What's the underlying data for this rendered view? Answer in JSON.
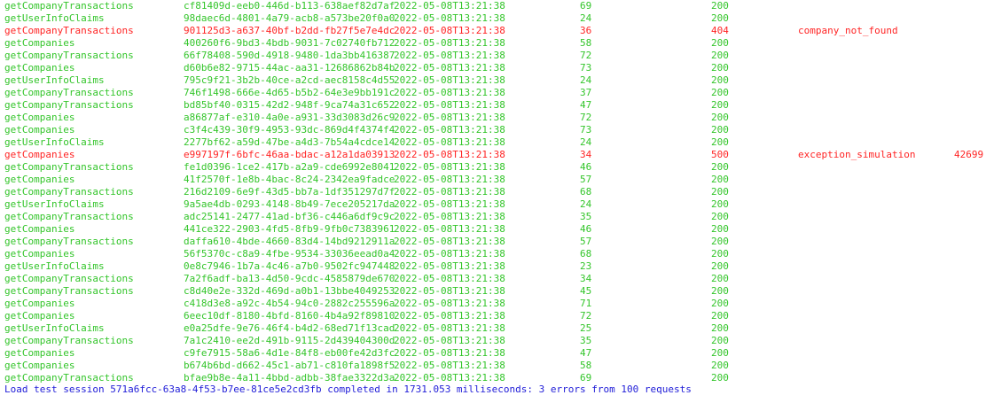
{
  "log": {
    "rows": [
      {
        "op": "getCompanyTransactions",
        "id": "cf81409d-eeb0-446d-b113-638aef82d7af",
        "ts": "2022-05-08T13:21:38",
        "ms": "69",
        "status": "200",
        "error": "",
        "extra": "",
        "is_error": false
      },
      {
        "op": "getUserInfoClaims",
        "id": "98daec6d-4801-4a79-acb8-a573be20f0a0",
        "ts": "2022-05-08T13:21:38",
        "ms": "24",
        "status": "200",
        "error": "",
        "extra": "",
        "is_error": false
      },
      {
        "op": "getCompanyTransactions",
        "id": "901125d3-a637-40bf-b2dd-fb27f5e7e4dc",
        "ts": "2022-05-08T13:21:38",
        "ms": "36",
        "status": "404",
        "error": "company_not_found",
        "extra": "",
        "is_error": true
      },
      {
        "op": "getCompanies",
        "id": "400260f6-9bd3-4bdb-9031-7c02740fb712",
        "ts": "2022-05-08T13:21:38",
        "ms": "58",
        "status": "200",
        "error": "",
        "extra": "",
        "is_error": false
      },
      {
        "op": "getCompanyTransactions",
        "id": "66f78408-590d-4918-9480-1da3bb416387",
        "ts": "2022-05-08T13:21:38",
        "ms": "72",
        "status": "200",
        "error": "",
        "extra": "",
        "is_error": false
      },
      {
        "op": "getCompanies",
        "id": "d60b6e82-9715-44ac-aa31-12686862b84b",
        "ts": "2022-05-08T13:21:38",
        "ms": "73",
        "status": "200",
        "error": "",
        "extra": "",
        "is_error": false
      },
      {
        "op": "getUserInfoClaims",
        "id": "795c9f21-3b2b-40ce-a2cd-aec8158c4d55",
        "ts": "2022-05-08T13:21:38",
        "ms": "24",
        "status": "200",
        "error": "",
        "extra": "",
        "is_error": false
      },
      {
        "op": "getCompanyTransactions",
        "id": "746f1498-666e-4d65-b5b2-64e3e9bb191c",
        "ts": "2022-05-08T13:21:38",
        "ms": "37",
        "status": "200",
        "error": "",
        "extra": "",
        "is_error": false
      },
      {
        "op": "getCompanyTransactions",
        "id": "bd85bf40-0315-42d2-948f-9ca74a31c652",
        "ts": "2022-05-08T13:21:38",
        "ms": "47",
        "status": "200",
        "error": "",
        "extra": "",
        "is_error": false
      },
      {
        "op": "getCompanies",
        "id": "a86877af-e310-4a0e-a931-33d3083d26c9",
        "ts": "2022-05-08T13:21:38",
        "ms": "72",
        "status": "200",
        "error": "",
        "extra": "",
        "is_error": false
      },
      {
        "op": "getCompanies",
        "id": "c3f4c439-30f9-4953-93dc-869d4f4374f4",
        "ts": "2022-05-08T13:21:38",
        "ms": "73",
        "status": "200",
        "error": "",
        "extra": "",
        "is_error": false
      },
      {
        "op": "getUserInfoClaims",
        "id": "2277bf62-a59d-47be-a4d3-7b54a4cdce14",
        "ts": "2022-05-08T13:21:38",
        "ms": "24",
        "status": "200",
        "error": "",
        "extra": "",
        "is_error": false
      },
      {
        "op": "getCompanies",
        "id": "e997197f-6bfc-46aa-bdac-a12a1da03913",
        "ts": "2022-05-08T13:21:38",
        "ms": "34",
        "status": "500",
        "error": "exception_simulation",
        "extra": "42699",
        "is_error": true
      },
      {
        "op": "getCompanyTransactions",
        "id": "fe1d0396-1ce2-417b-a2a9-cde6992e8041",
        "ts": "2022-05-08T13:21:38",
        "ms": "46",
        "status": "200",
        "error": "",
        "extra": "",
        "is_error": false
      },
      {
        "op": "getCompanies",
        "id": "41f2570f-1e8b-4bac-8c24-2342ea9fadce",
        "ts": "2022-05-08T13:21:38",
        "ms": "57",
        "status": "200",
        "error": "",
        "extra": "",
        "is_error": false
      },
      {
        "op": "getCompanyTransactions",
        "id": "216d2109-6e9f-43d5-bb7a-1df351297d7f",
        "ts": "2022-05-08T13:21:38",
        "ms": "68",
        "status": "200",
        "error": "",
        "extra": "",
        "is_error": false
      },
      {
        "op": "getUserInfoClaims",
        "id": "9a5ae4db-0293-4148-8b49-7ece205217da",
        "ts": "2022-05-08T13:21:38",
        "ms": "24",
        "status": "200",
        "error": "",
        "extra": "",
        "is_error": false
      },
      {
        "op": "getCompanyTransactions",
        "id": "adc25141-2477-41ad-bf36-c446a6df9c9c",
        "ts": "2022-05-08T13:21:38",
        "ms": "35",
        "status": "200",
        "error": "",
        "extra": "",
        "is_error": false
      },
      {
        "op": "getCompanies",
        "id": "441ce322-2903-4fd5-8fb9-9fb0c7383961",
        "ts": "2022-05-08T13:21:38",
        "ms": "46",
        "status": "200",
        "error": "",
        "extra": "",
        "is_error": false
      },
      {
        "op": "getCompanyTransactions",
        "id": "daffa610-4bde-4660-83d4-14bd9212911a",
        "ts": "2022-05-08T13:21:38",
        "ms": "57",
        "status": "200",
        "error": "",
        "extra": "",
        "is_error": false
      },
      {
        "op": "getCompanies",
        "id": "56f5370c-c8a9-4fbe-9534-33036eead0a4",
        "ts": "2022-05-08T13:21:38",
        "ms": "68",
        "status": "200",
        "error": "",
        "extra": "",
        "is_error": false
      },
      {
        "op": "getUserInfoClaims",
        "id": "0e8c7946-1b7a-4c46-a7b0-9502fc947448",
        "ts": "2022-05-08T13:21:38",
        "ms": "23",
        "status": "200",
        "error": "",
        "extra": "",
        "is_error": false
      },
      {
        "op": "getCompanyTransactions",
        "id": "7a2f6adf-ba13-4d50-9cdc-4585879de670",
        "ts": "2022-05-08T13:21:38",
        "ms": "34",
        "status": "200",
        "error": "",
        "extra": "",
        "is_error": false
      },
      {
        "op": "getCompanyTransactions",
        "id": "c8d40e2e-332d-469d-a0b1-13bbe4049253",
        "ts": "2022-05-08T13:21:38",
        "ms": "45",
        "status": "200",
        "error": "",
        "extra": "",
        "is_error": false
      },
      {
        "op": "getCompanies",
        "id": "c418d3e8-a92c-4b54-94c0-2882c255596a",
        "ts": "2022-05-08T13:21:38",
        "ms": "71",
        "status": "200",
        "error": "",
        "extra": "",
        "is_error": false
      },
      {
        "op": "getCompanies",
        "id": "6eec10df-8180-4bfd-8160-4b4a92f89810",
        "ts": "2022-05-08T13:21:38",
        "ms": "72",
        "status": "200",
        "error": "",
        "extra": "",
        "is_error": false
      },
      {
        "op": "getUserInfoClaims",
        "id": "e0a25dfe-9e76-46f4-b4d2-68ed71f13cad",
        "ts": "2022-05-08T13:21:38",
        "ms": "25",
        "status": "200",
        "error": "",
        "extra": "",
        "is_error": false
      },
      {
        "op": "getCompanyTransactions",
        "id": "7a1c2410-ee2d-491b-9115-2d439404300d",
        "ts": "2022-05-08T13:21:38",
        "ms": "35",
        "status": "200",
        "error": "",
        "extra": "",
        "is_error": false
      },
      {
        "op": "getCompanies",
        "id": "c9fe7915-58a6-4d1e-84f8-eb00fe42d3fc",
        "ts": "2022-05-08T13:21:38",
        "ms": "47",
        "status": "200",
        "error": "",
        "extra": "",
        "is_error": false
      },
      {
        "op": "getCompanies",
        "id": "b674b6bd-d662-45c1-ab71-c810fa1898f5",
        "ts": "2022-05-08T13:21:38",
        "ms": "58",
        "status": "200",
        "error": "",
        "extra": "",
        "is_error": false
      },
      {
        "op": "getCompanyTransactions",
        "id": "bfae9b8e-4a11-4bbd-adbb-38fae3322d3a",
        "ts": "2022-05-08T13:21:38",
        "ms": "69",
        "status": "200",
        "error": "",
        "extra": "",
        "is_error": false
      }
    ],
    "summary": "Load test session 571a6fcc-63a8-4f53-b7ee-81ce5e2cd3fb completed in 1731.053 milliseconds: 3 errors from 100 requests"
  },
  "colors": {
    "ok_text": "#33c52a",
    "error_text": "#ff2424",
    "summary_text": "#2320d8",
    "background": "#ffffff"
  }
}
